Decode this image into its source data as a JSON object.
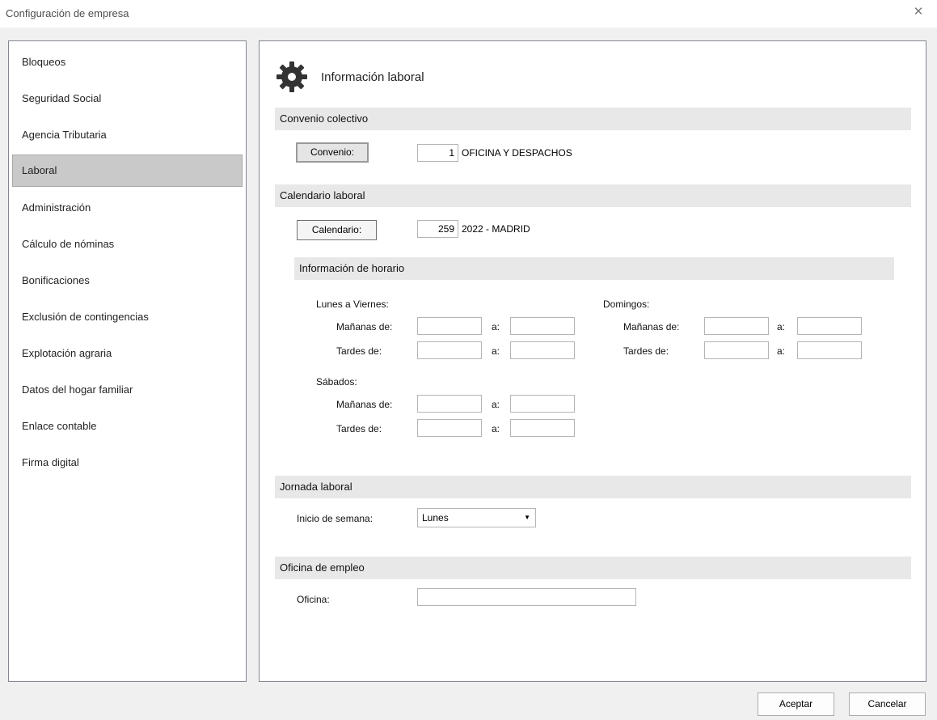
{
  "window": {
    "title": "Configuración de empresa",
    "close_symbol": "✕"
  },
  "sidebar": {
    "items": [
      {
        "label": "Bloqueos"
      },
      {
        "label": "Seguridad Social"
      },
      {
        "label": "Agencia Tributaria"
      },
      {
        "label": "Laboral"
      },
      {
        "label": "Administración"
      },
      {
        "label": "Cálculo de nóminas"
      },
      {
        "label": "Bonificaciones"
      },
      {
        "label": "Exclusión de contingencias"
      },
      {
        "label": "Explotación agraria"
      },
      {
        "label": "Datos del hogar familiar"
      },
      {
        "label": "Enlace contable"
      },
      {
        "label": "Firma digital"
      }
    ],
    "selected": "Laboral"
  },
  "page": {
    "title": "Información laboral",
    "icon": "gear-icon"
  },
  "convenio": {
    "section_title": "Convenio colectivo",
    "button_label": "Convenio:",
    "code": "1",
    "name": "OFICINA Y DESPACHOS"
  },
  "calendario": {
    "section_title": "Calendario laboral",
    "button_label": "Calendario:",
    "code": "259",
    "name": "2022 - MADRID"
  },
  "horario": {
    "section_title": "Información de horario",
    "weekdays": {
      "label": "Lunes a Viernes:",
      "morning_label": "Mañanas de:",
      "afternoon_label": "Tardes de:",
      "to_label": "a:"
    },
    "saturdays": {
      "label": "Sábados:",
      "morning_label": "Mañanas de:",
      "afternoon_label": "Tardes de:",
      "to_label": "a:"
    },
    "sundays": {
      "label": "Domingos:",
      "morning_label": "Mañanas de:",
      "afternoon_label": "Tardes de:",
      "to_label": "a:"
    }
  },
  "jornada": {
    "section_title": "Jornada laboral",
    "start_label": "Inicio de semana:",
    "start_value": "Lunes"
  },
  "oficina": {
    "section_title": "Oficina de empleo",
    "label": "Oficina:",
    "value": ""
  },
  "footer": {
    "accept_label": "Aceptar",
    "cancel_label": "Cancelar"
  }
}
